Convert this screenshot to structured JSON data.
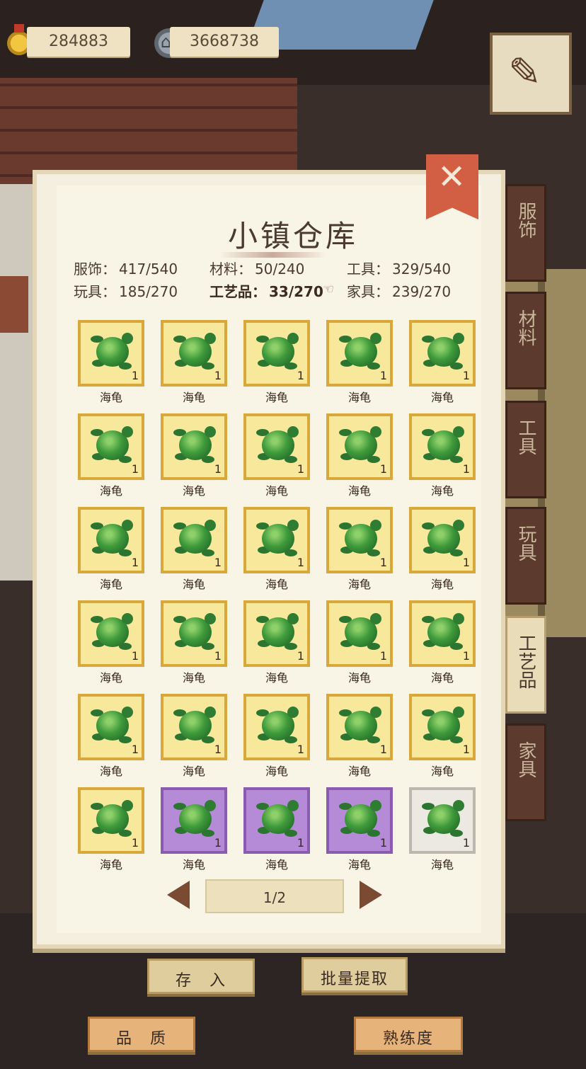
{
  "currency": {
    "gold": "284883",
    "silver": "3668738"
  },
  "title": "小镇仓库",
  "stats": [
    {
      "label": "服饰：",
      "value": "417/540",
      "active": false
    },
    {
      "label": "材料：",
      "value": "50/240",
      "active": false
    },
    {
      "label": "工具：",
      "value": "329/540",
      "active": false
    },
    {
      "label": "玩具：",
      "value": "185/270",
      "active": false
    },
    {
      "label": "工艺品：",
      "value": "33/270",
      "active": true
    },
    {
      "label": "家具：",
      "value": "239/270",
      "active": false
    }
  ],
  "tabs": [
    {
      "label": "服饰",
      "active": false
    },
    {
      "label": "材料",
      "active": false
    },
    {
      "label": "工具",
      "active": false
    },
    {
      "label": "玩具",
      "active": false
    },
    {
      "label": "工艺品",
      "active": true
    },
    {
      "label": "家具",
      "active": false
    }
  ],
  "items": [
    {
      "name": "海龟",
      "count": "1",
      "quality": "gold"
    },
    {
      "name": "海龟",
      "count": "1",
      "quality": "gold"
    },
    {
      "name": "海龟",
      "count": "1",
      "quality": "gold"
    },
    {
      "name": "海龟",
      "count": "1",
      "quality": "gold"
    },
    {
      "name": "海龟",
      "count": "1",
      "quality": "gold"
    },
    {
      "name": "海龟",
      "count": "1",
      "quality": "gold"
    },
    {
      "name": "海龟",
      "count": "1",
      "quality": "gold"
    },
    {
      "name": "海龟",
      "count": "1",
      "quality": "gold"
    },
    {
      "name": "海龟",
      "count": "1",
      "quality": "gold"
    },
    {
      "name": "海龟",
      "count": "1",
      "quality": "gold"
    },
    {
      "name": "海龟",
      "count": "1",
      "quality": "gold"
    },
    {
      "name": "海龟",
      "count": "1",
      "quality": "gold"
    },
    {
      "name": "海龟",
      "count": "1",
      "quality": "gold"
    },
    {
      "name": "海龟",
      "count": "1",
      "quality": "gold"
    },
    {
      "name": "海龟",
      "count": "1",
      "quality": "gold"
    },
    {
      "name": "海龟",
      "count": "1",
      "quality": "gold"
    },
    {
      "name": "海龟",
      "count": "1",
      "quality": "gold"
    },
    {
      "name": "海龟",
      "count": "1",
      "quality": "gold"
    },
    {
      "name": "海龟",
      "count": "1",
      "quality": "gold"
    },
    {
      "name": "海龟",
      "count": "1",
      "quality": "gold"
    },
    {
      "name": "海龟",
      "count": "1",
      "quality": "gold"
    },
    {
      "name": "海龟",
      "count": "1",
      "quality": "gold"
    },
    {
      "name": "海龟",
      "count": "1",
      "quality": "gold"
    },
    {
      "name": "海龟",
      "count": "1",
      "quality": "gold"
    },
    {
      "name": "海龟",
      "count": "1",
      "quality": "gold"
    },
    {
      "name": "海龟",
      "count": "1",
      "quality": "gold"
    },
    {
      "name": "海龟",
      "count": "1",
      "quality": "purple"
    },
    {
      "name": "海龟",
      "count": "1",
      "quality": "purple"
    },
    {
      "name": "海龟",
      "count": "1",
      "quality": "purple"
    },
    {
      "name": "海龟",
      "count": "1",
      "quality": "white"
    }
  ],
  "pager": {
    "text": "1/2"
  },
  "buttons": {
    "deposit": "存　入",
    "batch": "批量提取",
    "quality": "品　质",
    "proficiency": "熟练度"
  },
  "close_icon": "close-x",
  "colors": {
    "gold_slot": "#f7e89b",
    "purple_slot": "#b58ad6",
    "white_slot": "#ece9e2",
    "close": "#d25e44"
  }
}
